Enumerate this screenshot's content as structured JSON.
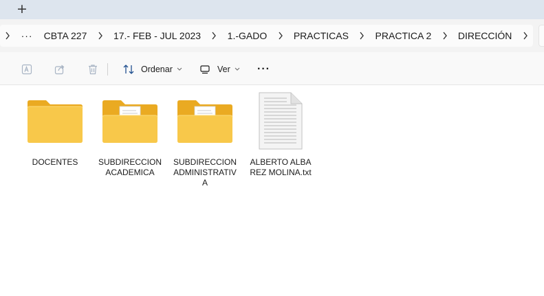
{
  "tabstrip": {
    "new_tab_label": "+"
  },
  "breadcrumb": {
    "more_label": "···",
    "items": [
      "CBTA 227",
      "17.- FEB - JUL 2023",
      "1.-GADO",
      "PRACTICAS",
      "PRACTICA 2",
      "DIRECCIÓN"
    ]
  },
  "toolbar": {
    "sort_label": "Ordenar",
    "view_label": "Ver",
    "more_label": "···"
  },
  "files": [
    {
      "name": "DOCENTES",
      "icon": "folder-icon"
    },
    {
      "name": "SUBDIRECCION ACADEMICA",
      "icon": "folder-with-documents-icon"
    },
    {
      "name": "SUBDIRECCION ADMINISTRATIVA",
      "icon": "folder-with-documents-icon"
    },
    {
      "name": "ALBERTO ALBAREZ MOLINA.txt",
      "icon": "text-file-icon"
    }
  ],
  "colors": {
    "folder": "#f8c84a",
    "folder_back": "#eaaa22",
    "toolbar_bg": "#f9f9f9",
    "tab_bg": "#dde5ee"
  }
}
